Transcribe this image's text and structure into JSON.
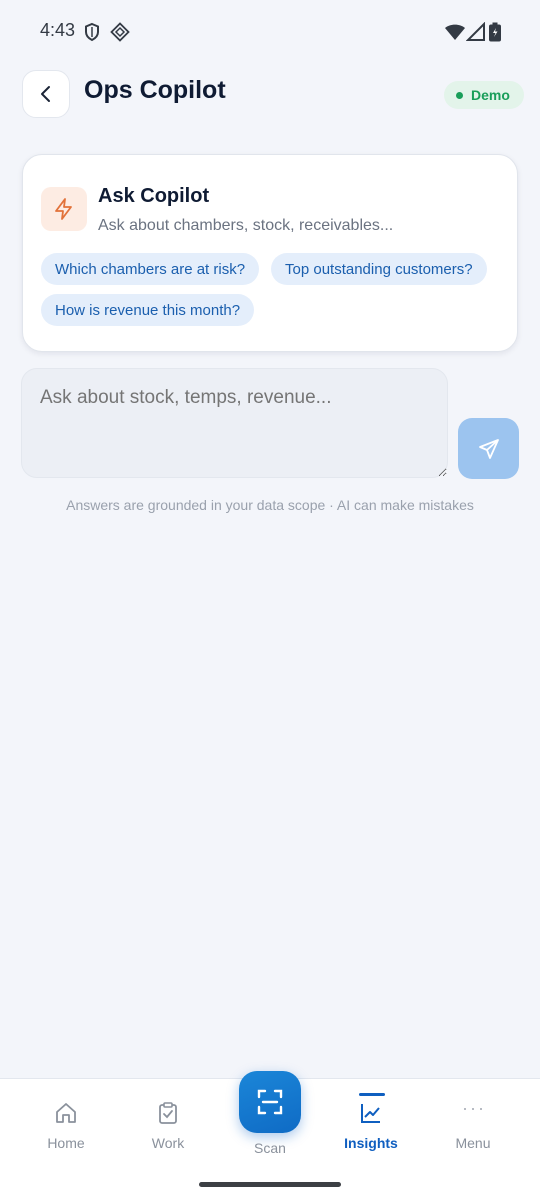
{
  "status_bar": {
    "time": "4:43",
    "icons": [
      "shield-icon",
      "diamond-icon",
      "wifi-icon",
      "signal-icon",
      "battery-icon"
    ]
  },
  "header": {
    "title": "Ops Copilot",
    "back_icon": "chevron-left-icon",
    "badge": {
      "label": "Demo",
      "color": "#1a9e5a"
    }
  },
  "card": {
    "icon": "lightning-icon",
    "title": "Ask Copilot",
    "subtitle": "Ask about chambers, stock, receivables...",
    "suggestions": [
      "Which chambers are at risk?",
      "Top outstanding customers?",
      "How is revenue this month?"
    ]
  },
  "input": {
    "placeholder": "Ask about stock, temps, revenue...",
    "value": ""
  },
  "send_button": {
    "icon": "send-icon"
  },
  "disclaimer": "Answers are grounded in your data scope · AI can make mistakes",
  "bottom_nav": {
    "items": [
      {
        "label": "Home",
        "icon": "home-icon"
      },
      {
        "label": "Work",
        "icon": "clipboard-icon"
      },
      {
        "label": "Scan",
        "icon": "scan-icon"
      },
      {
        "label": "Insights",
        "icon": "chart-icon",
        "active": true
      },
      {
        "label": "Menu",
        "icon": "more-icon"
      }
    ]
  },
  "colors": {
    "accent": "#0f5fc0",
    "background": "#f3f5fa",
    "chip_bg": "#e4eefb",
    "chip_text": "#1b5fae"
  }
}
